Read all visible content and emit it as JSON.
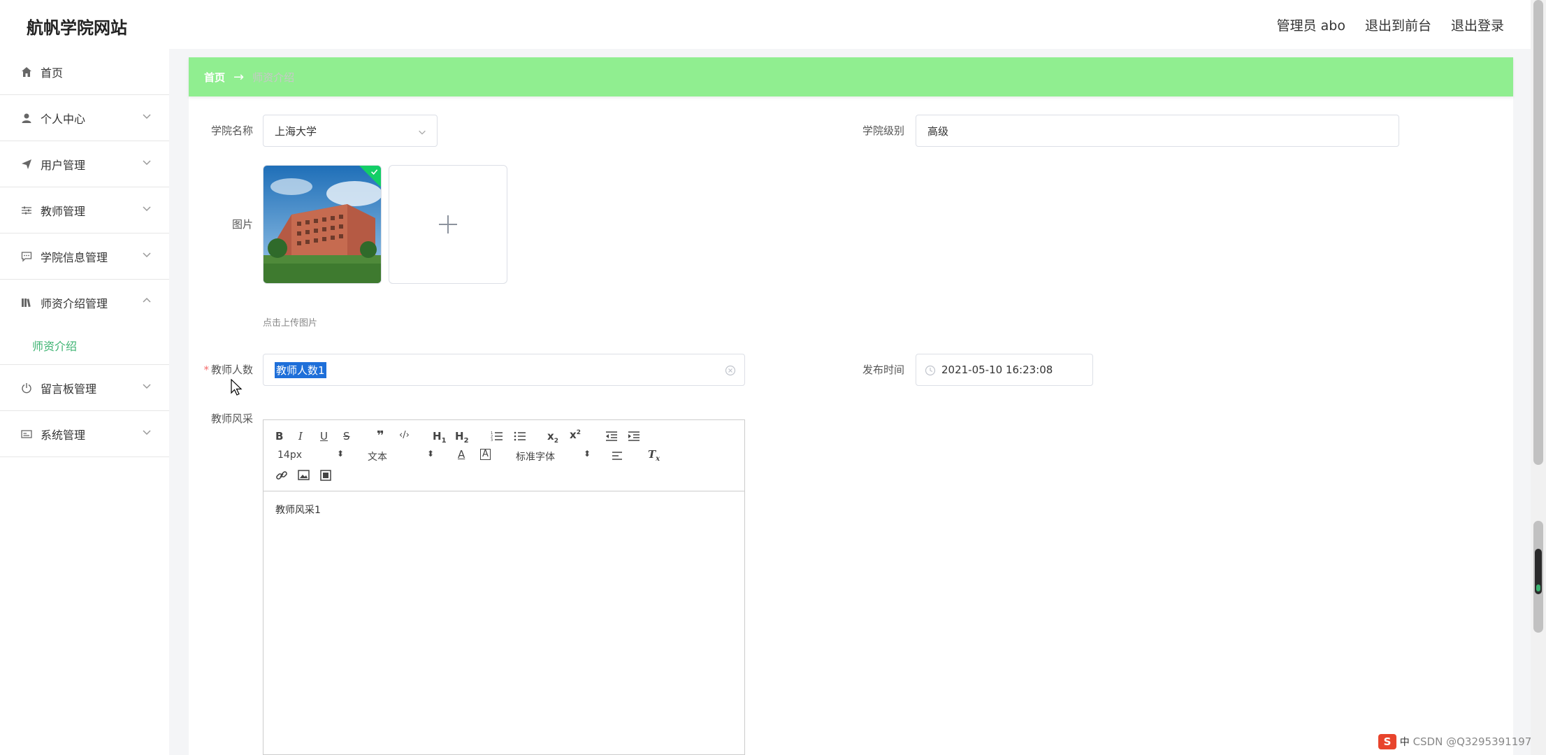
{
  "header": {
    "brand": "航帆学院网站",
    "admin": "管理员 abo",
    "to_front": "退出到前台",
    "logout": "退出登录"
  },
  "sidebar": {
    "items": [
      {
        "label": "首页",
        "icon": "home-icon"
      },
      {
        "label": "个人中心",
        "icon": "user-icon"
      },
      {
        "label": "用户管理",
        "icon": "send-icon"
      },
      {
        "label": "教师管理",
        "icon": "sliders-icon"
      },
      {
        "label": "学院信息管理",
        "icon": "chat-icon"
      },
      {
        "label": "师资介绍管理",
        "icon": "books-icon"
      },
      {
        "label": "留言板管理",
        "icon": "power-icon"
      },
      {
        "label": "系统管理",
        "icon": "card-icon"
      }
    ],
    "subitem": "师资介绍"
  },
  "breadcrumb": {
    "home": "首页",
    "arrow": "→",
    "current": "师资介绍"
  },
  "form": {
    "college_name_label": "学院名称",
    "college_name_value": "上海大学",
    "college_level_label": "学院级别",
    "college_level_value": "高级",
    "image_label": "图片",
    "upload_hint": "点击上传图片",
    "teacher_count_label": "教师人数",
    "teacher_count_value": "教师人数1",
    "publish_time_label": "发布时间",
    "publish_time_value": "2021-05-10 16:23:08",
    "teacher_style_label": "教师风采"
  },
  "editor": {
    "font_size": "14px",
    "header_select": "文本",
    "font_family": "标准字体",
    "content": "教师风采1"
  },
  "tray": {
    "watermark": "CSDN @Q3295391197"
  },
  "colors": {
    "breadcrumb_bg": "#90ee90",
    "active_submenu": "#3cb371",
    "selection": "#1e6fd9"
  }
}
